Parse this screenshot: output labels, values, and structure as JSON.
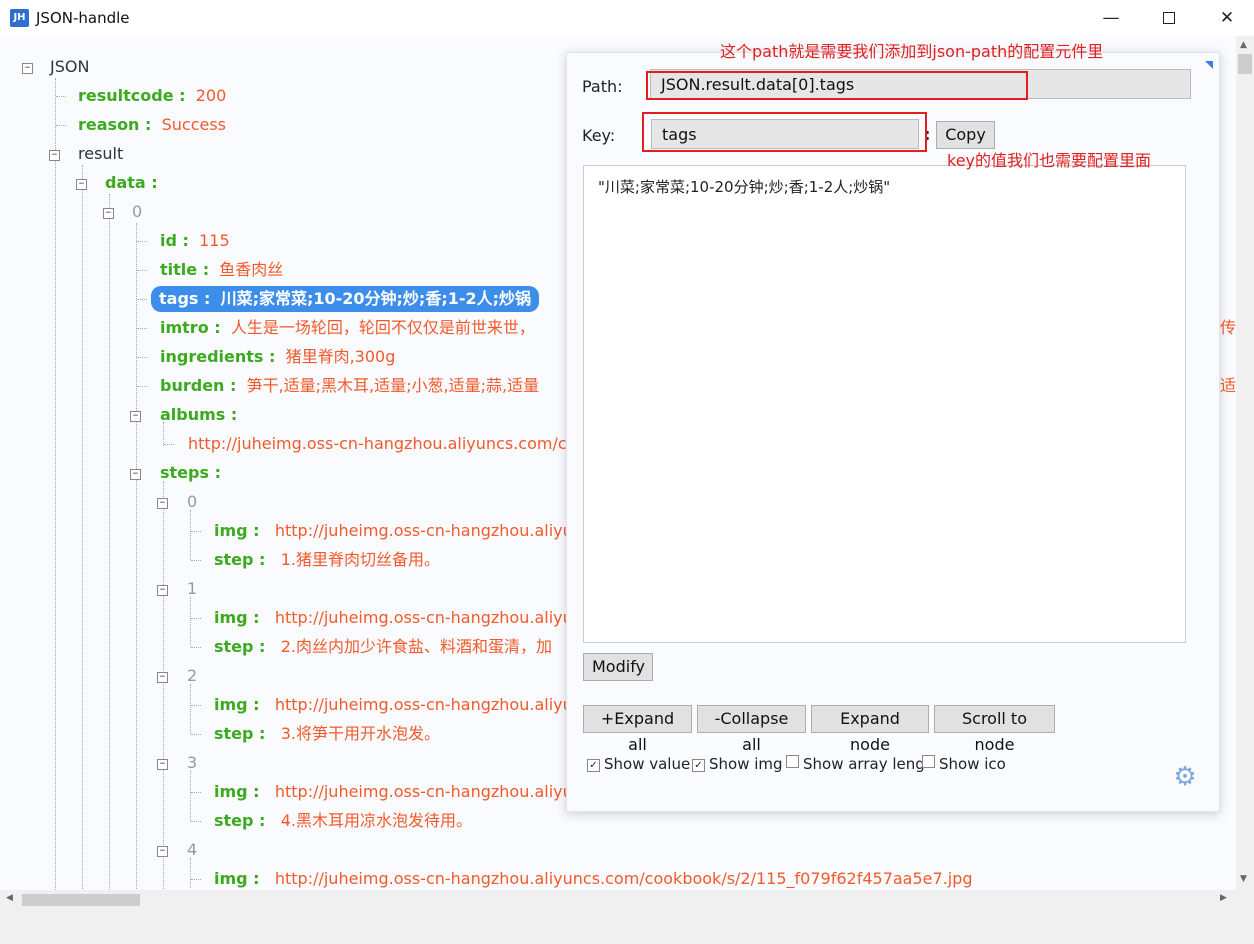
{
  "window": {
    "icon_text": "JH",
    "title": "JSON-handle"
  },
  "tree": {
    "root": "JSON",
    "resultcode_key": "resultcode :",
    "resultcode_val": "200",
    "reason_key": "reason :",
    "reason_val": "Success",
    "result_key": "result",
    "data_key": "data :",
    "idx0": "0",
    "id_key": "id :",
    "id_val": "115",
    "title_key": "title :",
    "title_val": "鱼香肉丝",
    "tags_key": "tags :",
    "tags_val": "川菜;家常菜;10-20分钟;炒;香;1-2人;炒锅",
    "imtro_key": "imtro :",
    "imtro_val": "人生是一场轮回，轮回不仅仅是前世来世，",
    "imtro_tail": "传",
    "ingredients_key": "ingredients :",
    "ingredients_val": "猪里脊肉,300g",
    "burden_key": "burden :",
    "burden_val": "笋干,适量;黑木耳,适量;小葱,适量;蒜,适量",
    "burden_tail": "适",
    "albums_key": "albums :",
    "albums_val": "http://juheimg.oss-cn-hangzhou.aliyuncs.com/coo",
    "steps_key": "steps :",
    "steps": [
      {
        "idx": "0",
        "img_key": "img :",
        "img_val": "http://juheimg.oss-cn-hangzhou.aliyu",
        "step_key": "step :",
        "step_val": "1.猪里脊肉切丝备用。"
      },
      {
        "idx": "1",
        "img_key": "img :",
        "img_val": "http://juheimg.oss-cn-hangzhou.aliyu",
        "step_key": "step :",
        "step_val": "2.肉丝内加少许食盐、料酒和蛋清，加"
      },
      {
        "idx": "2",
        "img_key": "img :",
        "img_val": "http://juheimg.oss-cn-hangzhou.aliyu",
        "step_key": "step :",
        "step_val": "3.将笋干用开水泡发。"
      },
      {
        "idx": "3",
        "img_key": "img :",
        "img_val": "http://juheimg.oss-cn-hangzhou.aliyu",
        "step_key": "step :",
        "step_val": "4.黑木耳用凉水泡发待用。"
      },
      {
        "idx": "4",
        "img_key": "img :",
        "img_val": "http://juheimg.oss-cn-hangzhou.aliyuncs.com/cookbook/s/2/115_f079f62f457aa5e7.jpg"
      }
    ]
  },
  "panel": {
    "path_label": "Path:",
    "path_value": "JSON.result.data[0].tags",
    "key_label": "Key:",
    "key_value": "tags",
    "copy_label": "Copy",
    "textarea_value": "\"川菜;家常菜;10-20分钟;炒;香;1-2人;炒锅\"",
    "modify_label": "Modify",
    "expand_all": "+Expand all",
    "collapse_all": "-Collapse all",
    "expand_node": "Expand node",
    "scroll_to_node": "Scroll to node",
    "show_value": "Show value",
    "show_img": "Show img",
    "show_array_leng": "Show array leng",
    "show_ico": "Show ico"
  },
  "annotations": {
    "path_note": "这个path就是需要我们添加到json-path的配置元件里",
    "key_note": "key的值我们也需要配置里面"
  },
  "colors": {
    "key": "#3caa1f",
    "value": "#f15a2b",
    "selected": "#3d8eea",
    "annotation": "#e02020"
  }
}
